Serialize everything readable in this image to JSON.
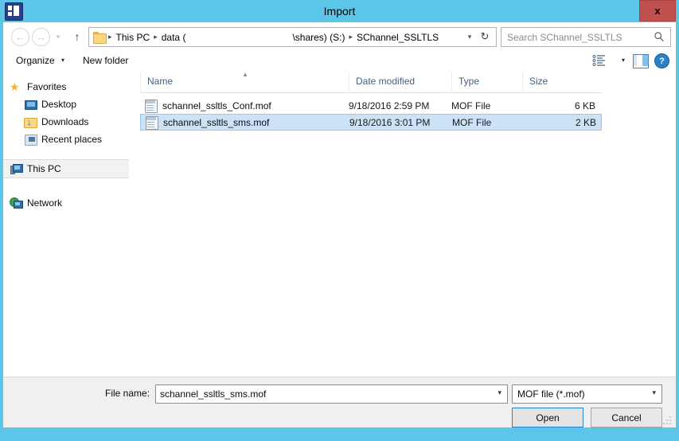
{
  "window": {
    "title": "Import",
    "app_icon": "application-window-icon",
    "close_label": "x",
    "frame_color": "#5bc6e8",
    "close_color": "#c0504d"
  },
  "nav": {
    "back_icon": "arrow-left-icon",
    "back_glyph": "←",
    "forward_icon": "arrow-right-icon",
    "forward_glyph": "→",
    "history_glyph": "▾",
    "up_glyph": "↑"
  },
  "address": {
    "folder_icon": "folder-icon",
    "crumbs": [
      "This PC",
      "data (",
      "\\shares) (S:)",
      "SChannel_SSLTLS"
    ],
    "separator": "▸",
    "chevron_glyph": "▾",
    "refresh_glyph": "↻"
  },
  "search": {
    "placeholder": "Search SChannel_SSLTLS",
    "icon": "search-icon"
  },
  "toolbar": {
    "organize_label": "Organize",
    "organize_caret": "▾",
    "new_folder_label": "New folder",
    "view_caret": "▾",
    "view_icon": "view-list-icon",
    "preview_pane_icon": "preview-pane-icon",
    "help_label": "?"
  },
  "sidebar": {
    "items": [
      {
        "label": "Favorites",
        "icon": "star-icon",
        "indent": false,
        "selected": false
      },
      {
        "label": "Desktop",
        "icon": "desktop-icon",
        "indent": true,
        "selected": false
      },
      {
        "label": "Downloads",
        "icon": "downloads-icon",
        "indent": true,
        "selected": false
      },
      {
        "label": "Recent places",
        "icon": "recent-places-icon",
        "indent": true,
        "selected": false
      },
      {
        "label": "This PC",
        "icon": "this-pc-icon",
        "indent": false,
        "selected": true
      },
      {
        "label": "Network",
        "icon": "network-icon",
        "indent": false,
        "selected": false
      }
    ]
  },
  "filelist": {
    "columns": [
      "Name",
      "Date modified",
      "Type",
      "Size"
    ],
    "sort_glyph": "▲",
    "rows": [
      {
        "name": "schannel_ssltls_Conf.mof",
        "date": "9/18/2016 2:59 PM",
        "type": "MOF File",
        "size": "6 KB",
        "icon": "mof-file-icon",
        "selected": false
      },
      {
        "name": "schannel_ssltls_sms.mof",
        "date": "9/18/2016 3:01 PM",
        "type": "MOF File",
        "size": "2 KB",
        "icon": "mof-file-icon",
        "selected": true
      }
    ]
  },
  "footer": {
    "filename_label": "File name:",
    "filename_value": "schannel_ssltls_sms.mof",
    "filename_caret": "▾",
    "filetype_value": "MOF file (*.mof)",
    "filetype_caret": "▾",
    "open_label": "Open",
    "cancel_label": "Cancel"
  }
}
